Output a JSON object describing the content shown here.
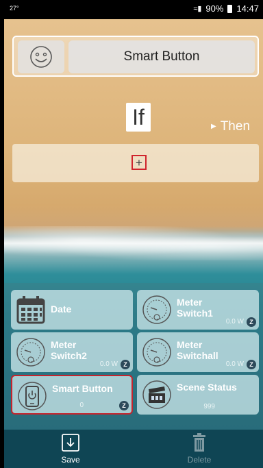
{
  "status_bar": {
    "left_text": "27°",
    "battery": "90%",
    "time": "14:47"
  },
  "header": {
    "title": "Smart Button",
    "icon": "smiley-face-icon"
  },
  "rule": {
    "if_label": "If",
    "then_label": "Then",
    "add_symbol": "+"
  },
  "devices": [
    {
      "name": "Date",
      "value": "",
      "icon": "calendar-icon",
      "zwave": false,
      "selected": false
    },
    {
      "name": "Meter\nSwitch1",
      "value": "0.0 W",
      "icon": "meter-gauge-icon",
      "zwave": true,
      "selected": false
    },
    {
      "name": "Meter\nSwitch2",
      "value": "0.0 W",
      "icon": "meter-gauge-icon",
      "zwave": true,
      "selected": false
    },
    {
      "name": "Meter\nSwitchall",
      "value": "0.0 W",
      "icon": "meter-gauge-icon",
      "zwave": true,
      "selected": false
    },
    {
      "name": "Smart Button",
      "value": "0",
      "icon": "power-phone-icon",
      "zwave": true,
      "selected": true
    },
    {
      "name": "Scene Status",
      "value": "999",
      "icon": "clapperboard-icon",
      "zwave": false,
      "selected": false
    }
  ],
  "zwave_badge": "Z",
  "bottom_bar": {
    "save_label": "Save",
    "delete_label": "Delete"
  },
  "colors": {
    "selected_border": "#c4242d",
    "bottom_bar": "#0f4554"
  }
}
